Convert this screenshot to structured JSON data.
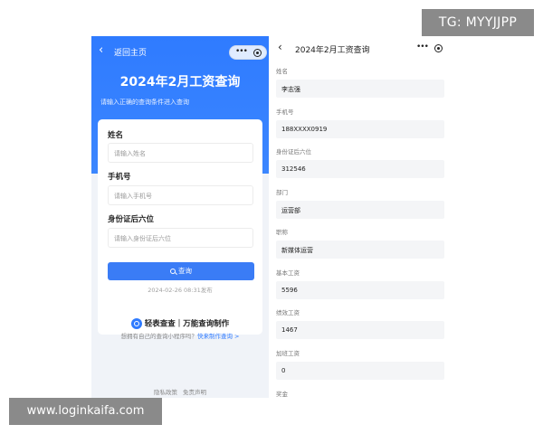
{
  "watermarks": {
    "top": "TG: MYYJJPP",
    "bottom": "www.loginkaifa.com"
  },
  "left": {
    "nav": {
      "back_label": "返回主页"
    },
    "title": "2024年2月工资查询",
    "subtitle": "请输入正确的查询条件进入查询",
    "fields": [
      {
        "label": "姓名",
        "placeholder": "请输入姓名"
      },
      {
        "label": "手机号",
        "placeholder": "请输入手机号"
      },
      {
        "label": "身份证后六位",
        "placeholder": "请输入身份证后六位"
      }
    ],
    "query_button": "查询",
    "published": "2024-02-26 08:31发布",
    "brand": "轻表查查｜万能查询制作",
    "promo_text": "想拥有自己的查询小程序吗？",
    "promo_link": "快来制作查询 >",
    "footer": {
      "privacy": "隐私政策",
      "disclaimer": "免责声明"
    },
    "colors": {
      "accent": "#2f7bff",
      "button": "#3a7cf6"
    }
  },
  "right": {
    "title": "2024年2月工资查询",
    "fields": [
      {
        "label": "姓名",
        "value": "李志强"
      },
      {
        "label": "手机号",
        "value": "188XXXX0919"
      },
      {
        "label": "身份证后六位",
        "value": "312546"
      },
      {
        "label": "部门",
        "value": "运营部"
      },
      {
        "label": "职称",
        "value": "新媒体运营"
      },
      {
        "label": "基本工资",
        "value": "5596"
      },
      {
        "label": "绩效工资",
        "value": "1467"
      },
      {
        "label": "加班工资",
        "value": "0"
      },
      {
        "label": "奖金",
        "value": ""
      }
    ]
  }
}
